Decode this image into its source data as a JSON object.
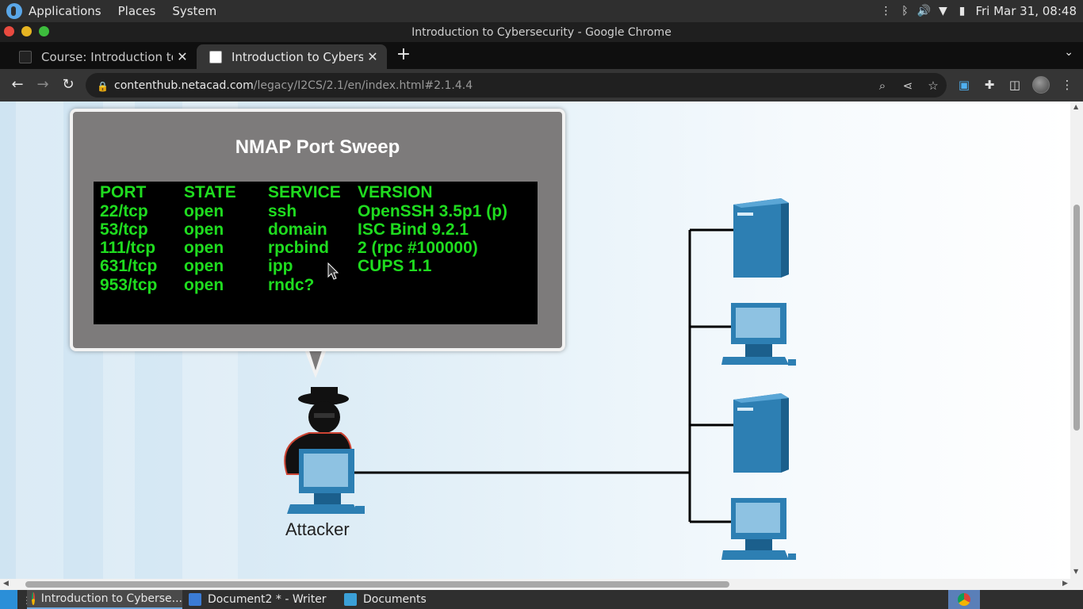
{
  "top_panel": {
    "menus": [
      "Applications",
      "Places",
      "System"
    ],
    "datetime": "Fri Mar 31, 08:48"
  },
  "window": {
    "title": "Introduction to Cybersecurity - Google Chrome"
  },
  "tabs": [
    {
      "label": "Course: Introduction to Cy",
      "active": false,
      "icon": "cisco-icon"
    },
    {
      "label": "Introduction to Cybersecur",
      "active": true,
      "icon": "cisco-icon"
    }
  ],
  "address_bar": {
    "host": "contenthub.netacad.com",
    "path": "/legacy/I2CS/2.1/en/index.html#2.1.4.4"
  },
  "figure": {
    "title": "NMAP Port Sweep",
    "columns": [
      "PORT",
      "STATE",
      "SERVICE",
      "VERSION"
    ],
    "rows": [
      [
        "22/tcp",
        "open",
        "ssh",
        "OpenSSH 3.5p1 (p)"
      ],
      [
        "53/tcp",
        "open",
        "domain",
        "ISC Bind 9.2.1"
      ],
      [
        "111/tcp",
        "open",
        "rpcbind",
        "2 (rpc #100000)"
      ],
      [
        "631/tcp",
        "open",
        "ipp",
        "CUPS 1.1"
      ],
      [
        "953/tcp",
        "open",
        "rndc?",
        ""
      ]
    ],
    "attacker_label": "Attacker"
  },
  "taskbar": {
    "items": [
      {
        "label": "Introduction to Cyberse...",
        "active": true
      },
      {
        "label": "Document2 * - Writer",
        "active": false
      },
      {
        "label": "Documents",
        "active": false
      }
    ]
  },
  "colors": {
    "terminal_text": "#1fdc1f",
    "device_blue": "#2d7fb3",
    "bubble_gray": "#7d7b7b"
  }
}
